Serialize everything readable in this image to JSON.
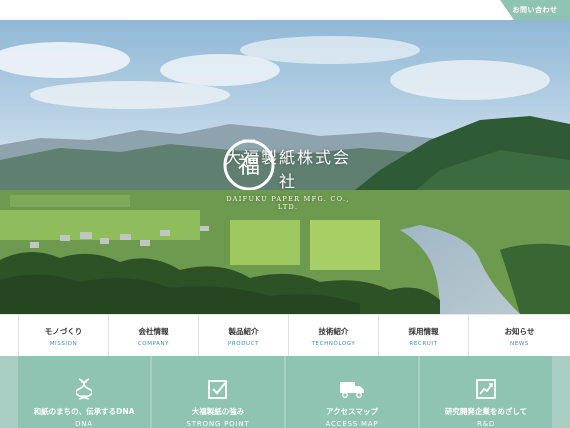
{
  "header": {
    "contact_label": "お問い合わせ"
  },
  "hero": {
    "company_name_jp": "大福製紙株式会社",
    "company_name_en": "DAIFUKU PAPER MFG. CO., LTD.",
    "logo_kanji": "福"
  },
  "nav": [
    {
      "jp": "モノづくり",
      "en": "MISSION"
    },
    {
      "jp": "会社情報",
      "en": "COMPANY"
    },
    {
      "jp": "製品紹介",
      "en": "PRODUCT"
    },
    {
      "jp": "技術紹介",
      "en": "TECHNOLOGY"
    },
    {
      "jp": "採用情報",
      "en": "RECRUIT"
    },
    {
      "jp": "お知らせ",
      "en": "NEWS"
    }
  ],
  "features": [
    {
      "jp": "和紙のまちの、伝承するDNA",
      "en": "DNA",
      "icon": "dna-icon"
    },
    {
      "jp": "大福製紙の強み",
      "en": "STRONG POINT",
      "icon": "checkbox-icon"
    },
    {
      "jp": "アクセスマップ",
      "en": "ACCESS MAP",
      "icon": "truck-icon"
    },
    {
      "jp": "研究開発企業をめざして",
      "en": "R&D",
      "icon": "chart-icon"
    }
  ],
  "colors": {
    "accent": "#8fc3b2",
    "nav_en": "#3b8fb0"
  }
}
